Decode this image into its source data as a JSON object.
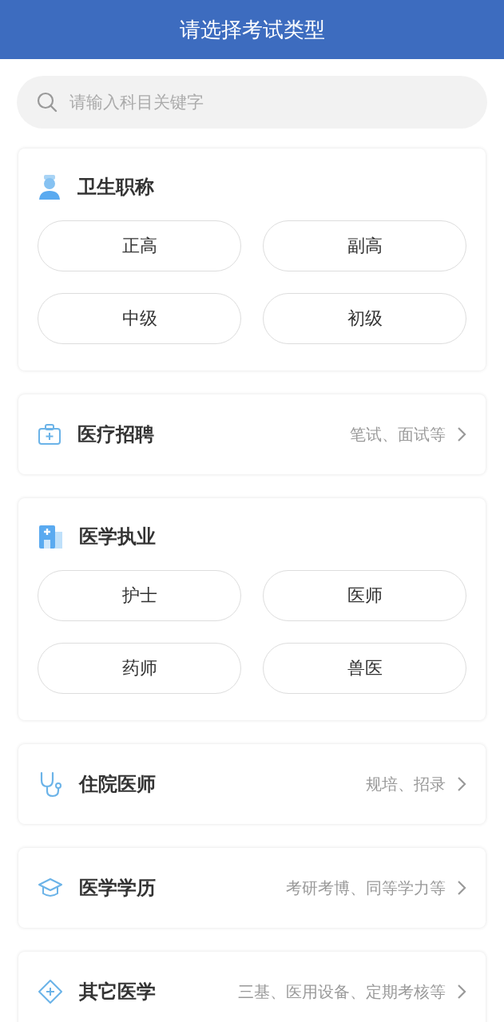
{
  "header": {
    "title": "请选择考试类型"
  },
  "search": {
    "placeholder": "请输入科目关键字"
  },
  "sections": [
    {
      "kind": "grid",
      "title": "卫生职称",
      "options": [
        "正高",
        "副高",
        "中级",
        "初级"
      ]
    },
    {
      "kind": "link",
      "title": "医疗招聘",
      "hint": "笔试、面试等"
    },
    {
      "kind": "grid",
      "title": "医学执业",
      "options": [
        "护士",
        "医师",
        "药师",
        "兽医"
      ]
    },
    {
      "kind": "link",
      "title": "住院医师",
      "hint": "规培、招录"
    },
    {
      "kind": "link",
      "title": "医学学历",
      "hint": "考研考博、同等学力等"
    },
    {
      "kind": "link",
      "title": "其它医学",
      "hint": "三基、医用设备、定期考核等"
    }
  ]
}
